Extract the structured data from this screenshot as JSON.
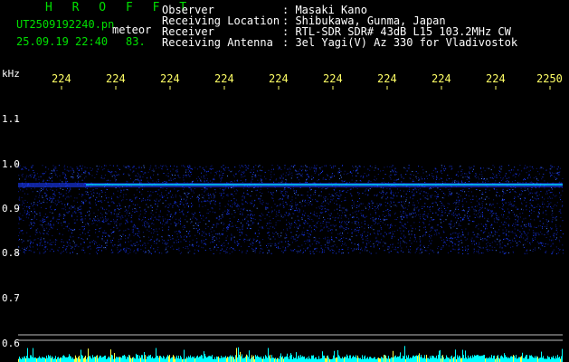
{
  "header": {
    "title": "H R O F F T",
    "file_name": "UT2509192240.pn",
    "file_suffix": "meteor",
    "date_time": "25.09.19 22:40",
    "count": "83.",
    "fields": [
      {
        "label": "Observer",
        "value": ": Masaki Kano"
      },
      {
        "label": "Receiving Location",
        "value": ": Shibukawa, Gunma, Japan"
      },
      {
        "label": "Receiver",
        "value": ": RTL-SDR SDR# 43dB L15 103.2MHz CW"
      },
      {
        "label": "Receiving Antenna",
        "value": ": 3el Yagi(V) Az 330 for Vladivostok"
      }
    ]
  },
  "y_axis": {
    "unit": "kHz",
    "ticks": [
      "1.1",
      "1.0",
      "0.9",
      "0.8",
      "0.7",
      "0.6"
    ]
  },
  "x_axis": {
    "ticks": [
      "224",
      "224",
      "224",
      "224",
      "224",
      "224",
      "224",
      "224",
      "224",
      "2250"
    ]
  },
  "colors": {
    "header_title": "#00e000",
    "header_text": "#ffffff",
    "x_ticks": "#ffff66",
    "echo_band": "#1a3cff",
    "echo_line": "#00e6ff",
    "baseline": "#00ffff"
  },
  "spectrogram": {
    "band_khz": [
      0.8,
      1.0
    ],
    "echo_line_khz": 0.955
  }
}
